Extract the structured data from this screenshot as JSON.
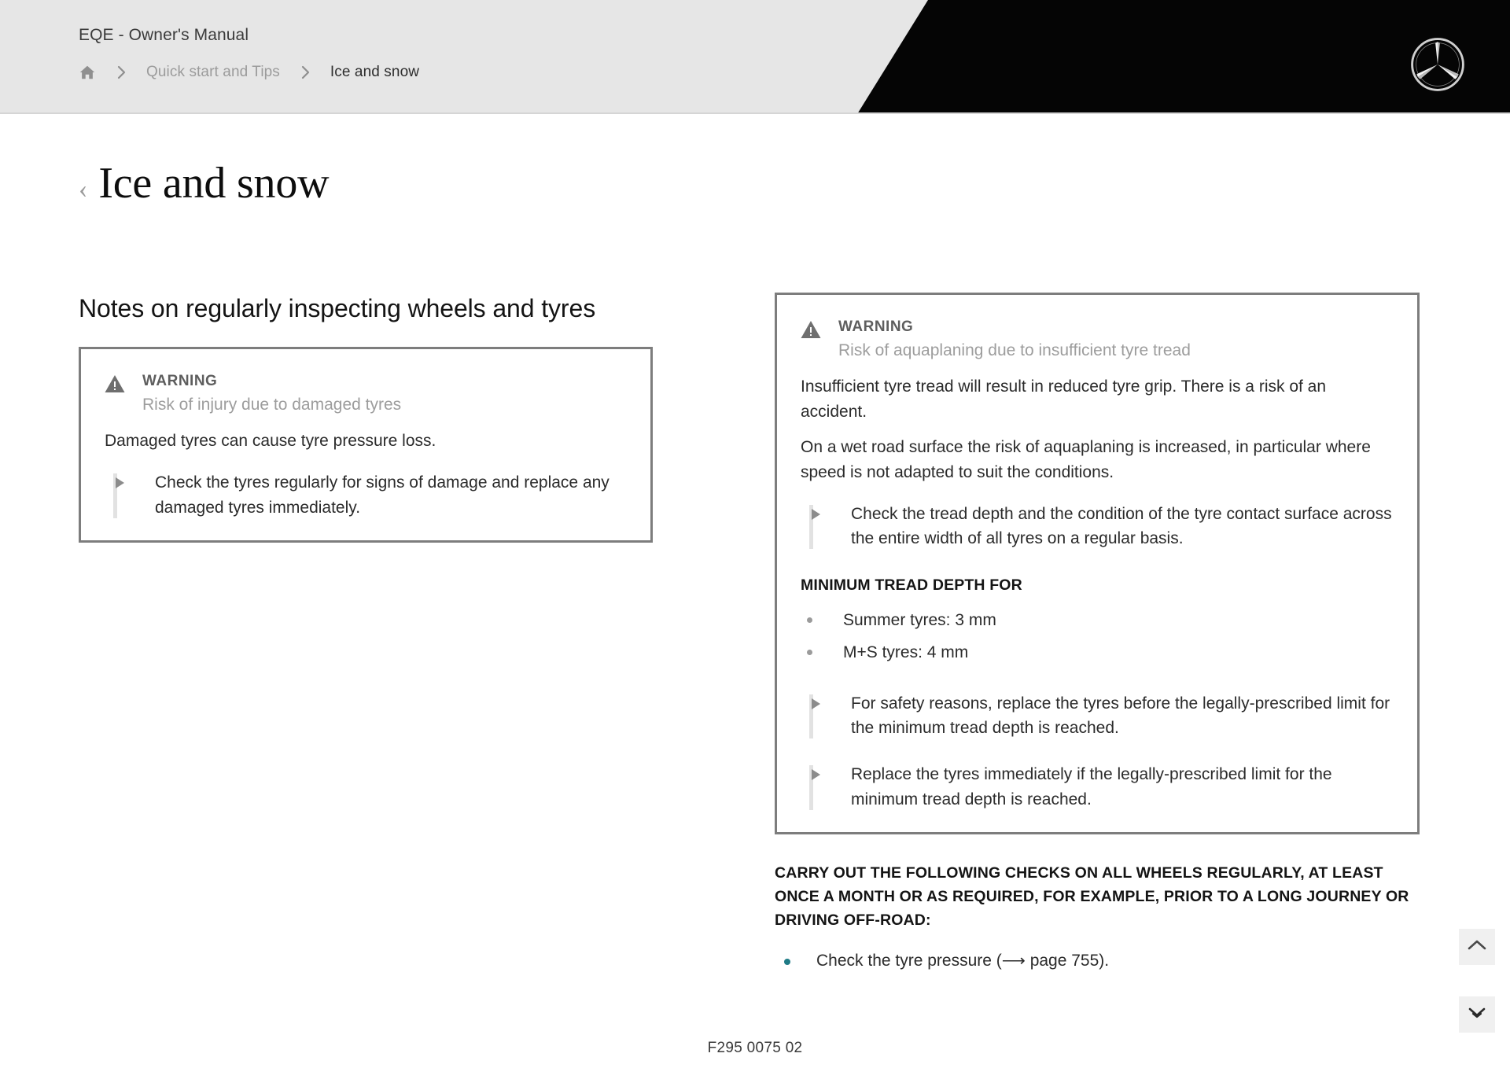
{
  "header": {
    "manual_title": "EQE - Owner's Manual",
    "breadcrumb": [
      {
        "label": "home",
        "icon": "home-icon"
      },
      {
        "label": "Quick start and Tips"
      },
      {
        "label": "Ice and snow"
      }
    ],
    "separator": "›",
    "logo": "mercedes-benz-star-logo",
    "black_banner_color": "#050505",
    "bar_color": "#e6e6e6"
  },
  "page": {
    "back_chevron": "‹",
    "title": "Ice and snow"
  },
  "left_column": {
    "section_heading": "Notes on regularly inspecting wheels and tyres",
    "warning": {
      "label": "WARNING",
      "subtitle": "Risk of injury due to damaged tyres",
      "body": "Damaged tyres can cause tyre pressure loss.",
      "actions": [
        "Check the tyres regularly for signs of damage and replace any damaged tyres immediately."
      ]
    }
  },
  "right_column": {
    "warning": {
      "label": "WARNING",
      "subtitle": "Risk of aquaplaning due to insufficient tyre tread",
      "paragraphs": [
        "Insufficient tyre tread will result in reduced tyre grip. There is a risk of an accident.",
        "On a wet road surface the risk of aquaplaning is increased, in particular where speed is not adapted to suit the conditions."
      ],
      "action_top": "Check the tread depth and the condition of the tyre contact surface across the entire width of all tyres on a regular basis.",
      "min_tread_heading": "MINIMUM TREAD DEPTH FOR",
      "tread_items": [
        "Summer tyres: 3 mm",
        "M+S tyres: 4 mm"
      ],
      "actions_bottom": [
        "For safety reasons, replace the tyres before the legally-prescribed limit for the minimum tread depth is reached.",
        "Replace the tyres immediately if the legally-prescribed limit for the minimum tread depth is reached."
      ]
    },
    "checks": {
      "heading": "CARRY OUT THE FOLLOWING CHECKS ON ALL WHEELS REGULARLY, AT LEAST ONCE A MONTH OR AS REQUIRED, FOR EXAMPLE, PRIOR TO A LONG JOURNEY OR DRIVING OFF-ROAD:",
      "links": [
        "Check the tyre pressure (⟶ page 755)."
      ],
      "link_bullet_color": "#1f7b86"
    }
  },
  "footer": {
    "code": "F295 0075 02"
  },
  "floating_buttons": [
    {
      "name": "scroll-to-top",
      "icon": "chevron-up-icon"
    },
    {
      "name": "next-section",
      "icon": "chevron-down-icon"
    }
  ]
}
